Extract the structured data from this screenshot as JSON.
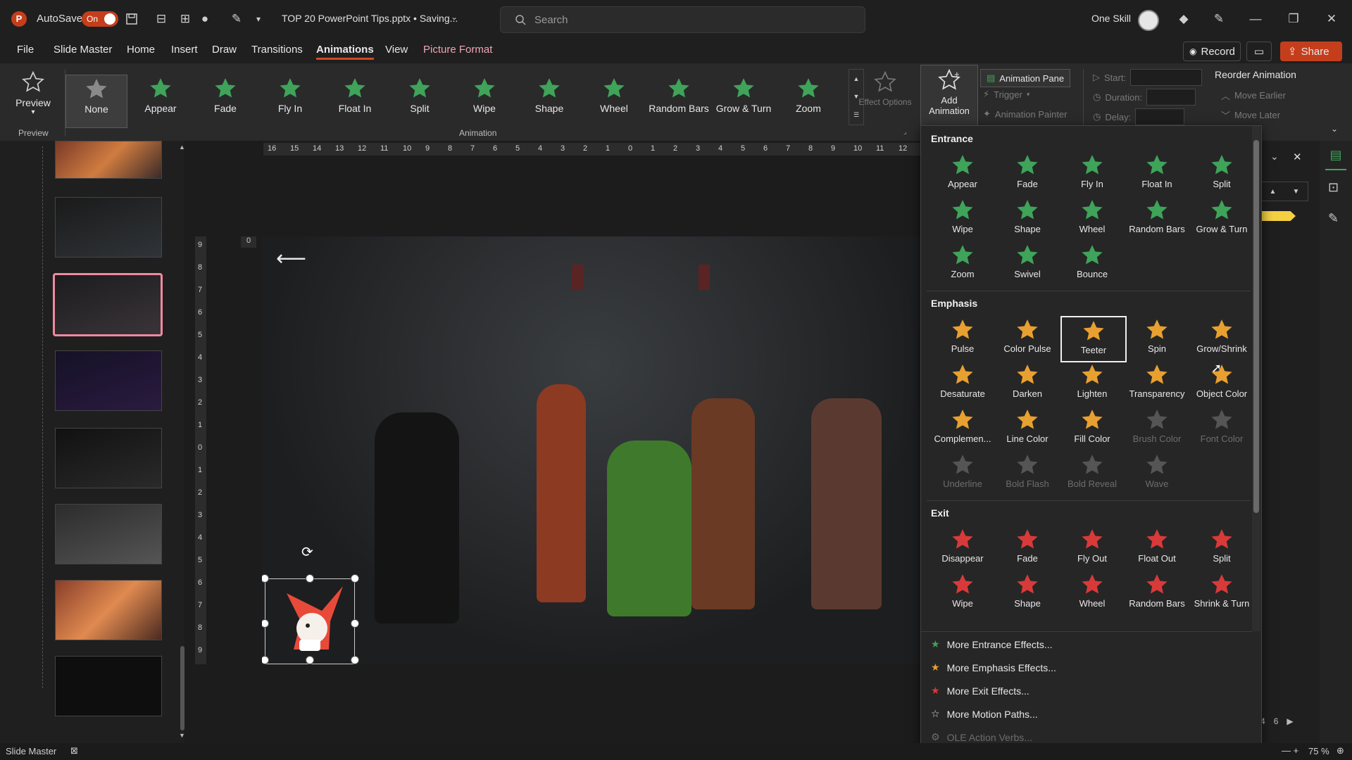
{
  "titlebar": {
    "autosave_label": "AutoSave",
    "toggle_state": "On",
    "filename": "TOP 20 PowerPoint Tips.pptx • Saving...",
    "search_placeholder": "Search",
    "user_name": "One Skill"
  },
  "menu": {
    "items": [
      "File",
      "Slide Master",
      "Home",
      "Insert",
      "Draw",
      "Transitions",
      "Animations",
      "View",
      "Picture Format"
    ],
    "active": "Animations",
    "record_label": "Record",
    "share_label": "Share"
  },
  "ribbon": {
    "preview_label": "Preview",
    "preview_group": "Preview",
    "animation_group": "Animation",
    "animations": [
      "None",
      "Appear",
      "Fade",
      "Fly In",
      "Float In",
      "Split",
      "Wipe",
      "Shape",
      "Wheel",
      "Random Bars",
      "Grow & Turn",
      "Zoom"
    ],
    "effect_options": "Effect Options",
    "add_animation": "Add Animation",
    "animation_pane": "Animation Pane",
    "trigger": "Trigger",
    "animation_painter": "Animation Painter",
    "start": "Start:",
    "duration": "Duration:",
    "delay": "Delay:",
    "reorder": "Reorder Animation",
    "move_earlier": "Move Earlier",
    "move_later": "Move Later"
  },
  "dropdown": {
    "entrance_title": "Entrance",
    "entrance": [
      "Appear",
      "Fade",
      "Fly In",
      "Float In",
      "Split",
      "Wipe",
      "Shape",
      "Wheel",
      "Random Bars",
      "Grow & Turn",
      "Zoom",
      "Swivel",
      "Bounce"
    ],
    "emphasis_title": "Emphasis",
    "emphasis": [
      "Pulse",
      "Color Pulse",
      "Teeter",
      "Spin",
      "Grow/Shrink",
      "Desaturate",
      "Darken",
      "Lighten",
      "Transparency",
      "Object Color",
      "Complemen...",
      "Line Color",
      "Fill Color",
      "Brush Color",
      "Font Color",
      "Underline",
      "Bold Flash",
      "Bold Reveal",
      "Wave"
    ],
    "emphasis_disabled": [
      "Brush Color",
      "Font Color",
      "Underline",
      "Bold Flash",
      "Bold Reveal",
      "Wave"
    ],
    "emphasis_highlighted": "Teeter",
    "exit_title": "Exit",
    "exit": [
      "Disappear",
      "Fade",
      "Fly Out",
      "Float Out",
      "Split",
      "Wipe",
      "Shape",
      "Wheel",
      "Random Bars",
      "Shrink & Turn"
    ],
    "more": [
      "More Entrance Effects...",
      "More Emphasis Effects...",
      "More Exit Effects...",
      "More Motion Paths...",
      "OLE Action Verbs..."
    ]
  },
  "ruler": {
    "h_ticks": [
      "16",
      "15",
      "14",
      "13",
      "12",
      "11",
      "10",
      "9",
      "8",
      "7",
      "6",
      "5",
      "4",
      "3",
      "2",
      "1",
      "0",
      "1",
      "2",
      "3",
      "4",
      "5",
      "6",
      "7",
      "8",
      "9",
      "10",
      "11",
      "12"
    ],
    "v_ticks": [
      "9",
      "8",
      "7",
      "6",
      "5",
      "4",
      "3",
      "2",
      "1",
      "0",
      "1",
      "2",
      "3",
      "4",
      "5",
      "6",
      "7",
      "8",
      "9"
    ]
  },
  "slide": {
    "index_badge": "0"
  },
  "status": {
    "mode": "Slide Master",
    "zoom": "75 %",
    "page_nums": [
      "4",
      "6"
    ]
  },
  "colors": {
    "accent": "#c43e1c",
    "entrance": "#3fa35a",
    "emphasis": "#e8a030",
    "exit": "#d83a3a"
  }
}
